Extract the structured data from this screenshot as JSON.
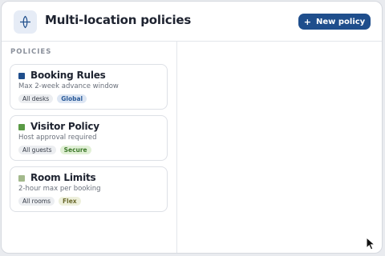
{
  "header": {
    "title": "Multi-location policies",
    "new_button_icon": "plus-icon",
    "new_button_plus": "+",
    "new_button_label": "New policy",
    "app_icon": "location-pin-icon",
    "accent": "#1f4e8c"
  },
  "sidebar": {
    "section_label": "POLICIES",
    "policies": [
      {
        "title": "Booking Rules",
        "description": "Max 2-week advance window",
        "scope": "All desks",
        "tag": "Global",
        "swatch_color": "#1f4e8c",
        "tag_bg": "#dde6f3",
        "tag_color": "#2a5a99"
      },
      {
        "title": "Visitor Policy",
        "description": "Host approval required",
        "scope": "All guests",
        "tag": "Secure",
        "swatch_color": "#5a9a45",
        "tag_bg": "#e1f0d6",
        "tag_color": "#3f7a2c"
      },
      {
        "title": "Room Limits",
        "description": "2-hour max per booking",
        "scope": "All rooms",
        "tag": "Flex",
        "swatch_color": "#a3b98c",
        "tag_bg": "#eef0dc",
        "tag_color": "#6b6a2e"
      }
    ]
  }
}
